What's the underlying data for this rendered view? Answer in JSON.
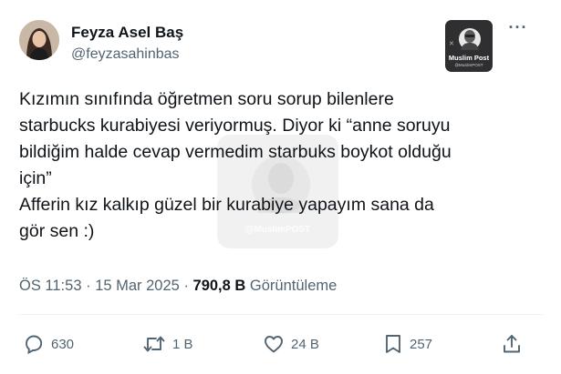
{
  "author": {
    "display_name": "Feyza Asel Baş",
    "handle": "@feyzasahinbas"
  },
  "badge": {
    "title": "Muslim Post",
    "subtitle": "@MuslimPOST"
  },
  "watermark": {
    "label": "@MuslimPOST"
  },
  "tweet": {
    "lines": [
      "Kızımın sınıfında öğretmen soru sorup bilenlere",
      "starbucks kurabiyesi veriyormuş. Diyor ki “anne soruyu",
      "bildiğim halde cevap vermedim starbuks boykot olduğu",
      "için”",
      "Afferin  kız kalkıp güzel bir kurabiye yapayım sana da",
      "gör sen :)"
    ]
  },
  "meta": {
    "time": "ÖS 11:53",
    "separator": "·",
    "date": "15 Mar 2025",
    "views_count": "790,8 B",
    "views_label": "Görüntüleme"
  },
  "actions": {
    "replies": "630",
    "reposts": "1 B",
    "likes": "24 B",
    "bookmarks": "257"
  },
  "icons": {
    "more": "more-horizontal-icon",
    "reply": "reply-icon",
    "repost": "repost-icon",
    "like": "heart-icon",
    "bookmark": "bookmark-icon",
    "share": "share-icon"
  }
}
